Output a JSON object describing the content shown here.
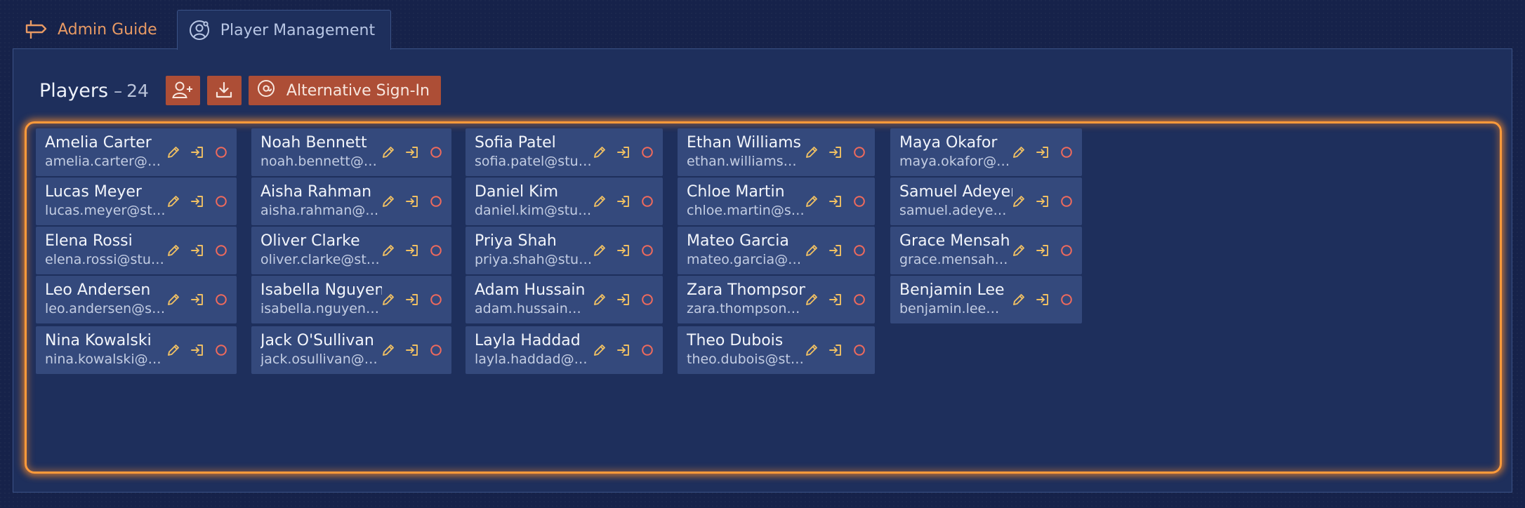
{
  "tabs": [
    {
      "label": "Admin Guide",
      "icon": "signpost-icon"
    },
    {
      "label": "Player Management",
      "icon": "user-gear-icon"
    }
  ],
  "header": {
    "title": "Players",
    "separator": "–",
    "count": "24",
    "add_player_icon": "user-plus-icon",
    "download_icon": "download-icon",
    "alt_signin_label": "Alternative Sign-In",
    "alt_signin_icon": "at-sign-icon"
  },
  "colors": {
    "accent": "#ad4e36",
    "glow": "#ff9a3a",
    "edit_icon": "#f0c063",
    "signin_icon": "#f0c063",
    "status_icon": "#f06a5c"
  },
  "card_actions": [
    "pencil-icon",
    "sign-in-icon",
    "status-circle-icon"
  ],
  "players": [
    {
      "name": "Amelia Carter",
      "email": "amelia.carter@students.e..."
    },
    {
      "name": "Noah Bennett",
      "email": "noah.bennett@students.e..."
    },
    {
      "name": "Sofia Patel",
      "email": "sofia.patel@students.exa..."
    },
    {
      "name": "Ethan Williams",
      "email": "ethan.williams@students...."
    },
    {
      "name": "Maya Okafor",
      "email": "maya.okafor@students.ex..."
    },
    {
      "name": "Lucas Meyer",
      "email": "lucas.meyer@students.ex..."
    },
    {
      "name": "Aisha Rahman",
      "email": "aisha.rahman@students.e..."
    },
    {
      "name": "Daniel Kim",
      "email": "daniel.kim@students.exa..."
    },
    {
      "name": "Chloe Martin",
      "email": "chloe.martin@students.ex..."
    },
    {
      "name": "Samuel Adeyemi",
      "email": "samuel.adeyemi@student..."
    },
    {
      "name": "Elena Rossi",
      "email": "elena.rossi@students.exa..."
    },
    {
      "name": "Oliver Clarke",
      "email": "oliver.clarke@students.ex..."
    },
    {
      "name": "Priya Shah",
      "email": "priya.shah@students.exa..."
    },
    {
      "name": "Mateo Garcia",
      "email": "mateo.garcia@students.e..."
    },
    {
      "name": "Grace Mensah",
      "email": "grace.mensah@students...."
    },
    {
      "name": "Leo Andersen",
      "email": "leo.andersen@students.ex..."
    },
    {
      "name": "Isabella Nguyen",
      "email": "isabella.nguyen@students..."
    },
    {
      "name": "Adam Hussain",
      "email": "adam.hussain@students.e..."
    },
    {
      "name": "Zara Thompson",
      "email": "zara.thompson@students...."
    },
    {
      "name": "Benjamin Lee",
      "email": "benjamin.lee@students.ex..."
    },
    {
      "name": "Nina Kowalski",
      "email": "nina.kowalski@students.e..."
    },
    {
      "name": "Jack O'Sullivan",
      "email": "jack.osullivan@students.e..."
    },
    {
      "name": "Layla Haddad",
      "email": "layla.haddad@students.ex..."
    },
    {
      "name": "Theo Dubois",
      "email": "theo.dubois@students.exa..."
    }
  ]
}
